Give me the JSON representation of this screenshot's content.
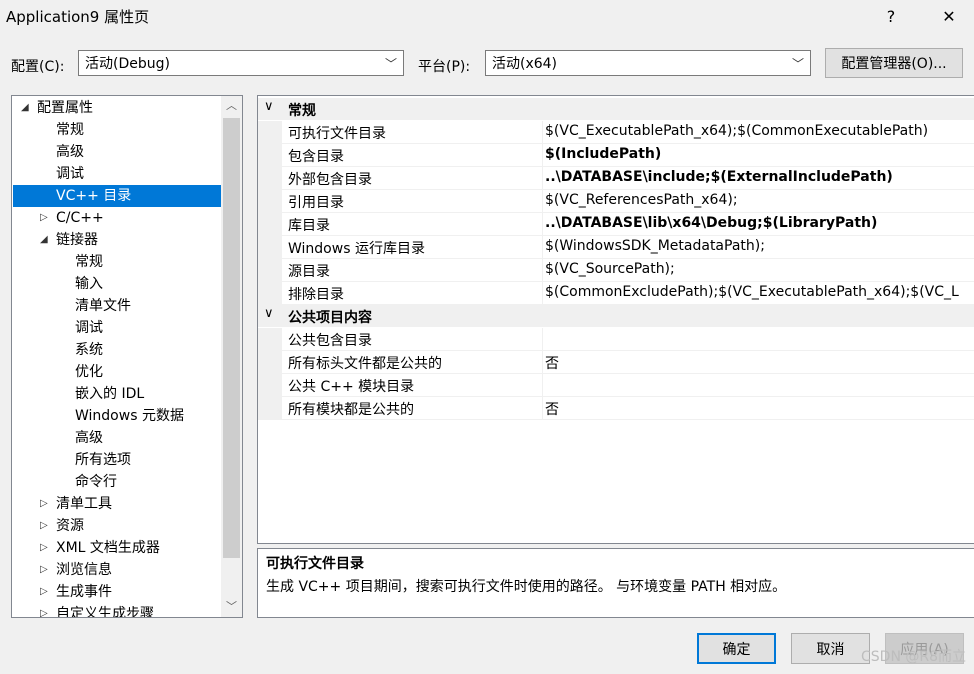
{
  "window": {
    "title": "Application9 属性页",
    "help_label": "?",
    "close_label": "✕"
  },
  "toolbar": {
    "config_label": "配置(C):",
    "config_value": "活动(Debug)",
    "platform_label": "平台(P):",
    "platform_value": "活动(x64)",
    "manager_label": "配置管理器(O)..."
  },
  "tree": {
    "items": [
      {
        "label": "配置属性",
        "expand": "◢"
      },
      {
        "label": "常规"
      },
      {
        "label": "高级"
      },
      {
        "label": "调试"
      },
      {
        "label": "VC++ 目录"
      },
      {
        "label": "C/C++",
        "expand": "▷"
      },
      {
        "label": "链接器",
        "expand": "◢"
      },
      {
        "label": "常规"
      },
      {
        "label": "输入"
      },
      {
        "label": "清单文件"
      },
      {
        "label": "调试"
      },
      {
        "label": "系统"
      },
      {
        "label": "优化"
      },
      {
        "label": "嵌入的 IDL"
      },
      {
        "label": "Windows 元数据"
      },
      {
        "label": "高级"
      },
      {
        "label": "所有选项"
      },
      {
        "label": "命令行"
      },
      {
        "label": "清单工具",
        "expand": "▷"
      },
      {
        "label": "资源",
        "expand": "▷"
      },
      {
        "label": "XML 文档生成器",
        "expand": "▷"
      },
      {
        "label": "浏览信息",
        "expand": "▷"
      },
      {
        "label": "生成事件",
        "expand": "▷"
      },
      {
        "label": "自定义生成步骤",
        "expand": "▷"
      }
    ],
    "selected": "VC++ 目录"
  },
  "grid": {
    "categories": [
      {
        "name": "常规",
        "chevron": "∨"
      },
      {
        "name": "公共项目内容",
        "chevron": "∨"
      }
    ],
    "general": [
      {
        "name": "可执行文件目录",
        "value": "$(VC_ExecutablePath_x64);$(CommonExecutablePath)"
      },
      {
        "name": "包含目录",
        "value": "$(IncludePath)"
      },
      {
        "name": "外部包含目录",
        "value": "..\\DATABASE\\include;$(ExternalIncludePath)"
      },
      {
        "name": "引用目录",
        "value": "$(VC_ReferencesPath_x64);"
      },
      {
        "name": "库目录",
        "value": "..\\DATABASE\\lib\\x64\\Debug;$(LibraryPath)"
      },
      {
        "name": "Windows 运行库目录",
        "value": "$(WindowsSDK_MetadataPath);"
      },
      {
        "name": "源目录",
        "value": "$(VC_SourcePath);"
      },
      {
        "name": "排除目录",
        "value": "$(CommonExcludePath);$(VC_ExecutablePath_x64);$(VC_L"
      }
    ],
    "public": [
      {
        "name": "公共包含目录",
        "value": ""
      },
      {
        "name": "所有标头文件都是公共的",
        "value": "否"
      },
      {
        "name": "公共 C++ 模块目录",
        "value": ""
      },
      {
        "name": "所有模块都是公共的",
        "value": "否"
      }
    ]
  },
  "description": {
    "title": "可执行文件目录",
    "text": "生成 VC++ 项目期间，搜索可执行文件时使用的路径。 与环境变量 PATH 相对应。"
  },
  "buttons": {
    "ok": "确定",
    "cancel": "取消",
    "apply": "应用(A)"
  },
  "watermark": "CSDN @R8而立"
}
